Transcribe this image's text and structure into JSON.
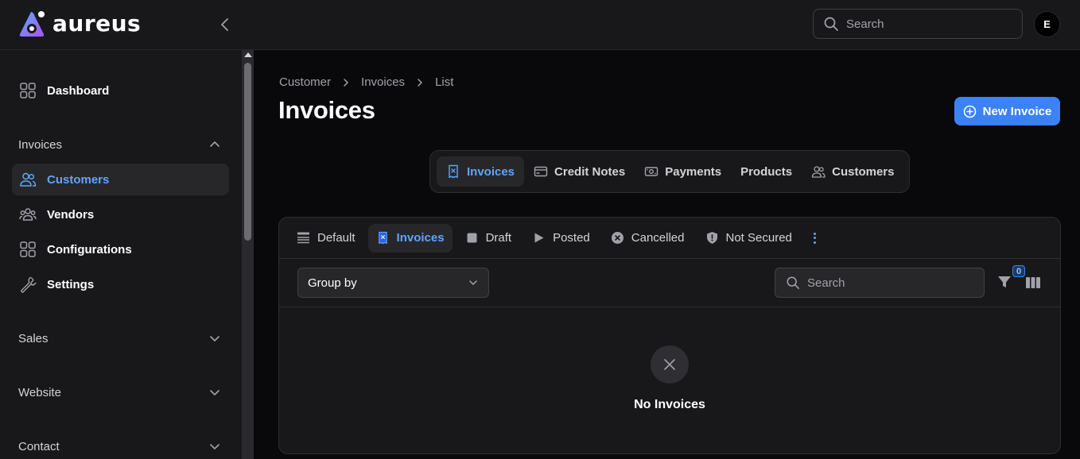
{
  "app": {
    "name": "aureus"
  },
  "header": {
    "search_placeholder": "Search",
    "avatar_initial": "E"
  },
  "sidebar": {
    "items": [
      {
        "label": "Dashboard",
        "icon": "grid-icon"
      }
    ],
    "groups": [
      {
        "label": "Invoices",
        "expanded": true,
        "items": [
          {
            "label": "Customers",
            "icon": "users-icon",
            "active": true
          },
          {
            "label": "Vendors",
            "icon": "group-icon"
          },
          {
            "label": "Configurations",
            "icon": "grid-icon"
          },
          {
            "label": "Settings",
            "icon": "wrench-icon"
          }
        ]
      },
      {
        "label": "Sales",
        "expanded": false
      },
      {
        "label": "Website",
        "expanded": false
      },
      {
        "label": "Contact",
        "expanded": false
      }
    ]
  },
  "main": {
    "breadcrumb": [
      "Customer",
      "Invoices",
      "List"
    ],
    "title": "Invoices",
    "new_button": "New Invoice",
    "tabs": [
      {
        "label": "Invoices",
        "icon": "receipt-icon",
        "active": true
      },
      {
        "label": "Credit Notes",
        "icon": "credit-card-icon"
      },
      {
        "label": "Payments",
        "icon": "banknote-icon"
      },
      {
        "label": "Products",
        "icon": ""
      },
      {
        "label": "Customers",
        "icon": "users-icon"
      }
    ],
    "filters": [
      {
        "label": "Default",
        "icon": "list-icon"
      },
      {
        "label": "Invoices",
        "icon": "receipt-icon",
        "active": true
      },
      {
        "label": "Draft",
        "icon": "square-icon"
      },
      {
        "label": "Posted",
        "icon": "play-icon"
      },
      {
        "label": "Cancelled",
        "icon": "x-circle-icon"
      },
      {
        "label": "Not Secured",
        "icon": "shield-alert-icon"
      }
    ],
    "group_by": {
      "value": "Group by"
    },
    "table_search_placeholder": "Search",
    "filter_count": "0",
    "empty_message": "No Invoices"
  },
  "colors": {
    "accent": "#3b82f6",
    "active_text": "#60a5fa",
    "background": "#09090b",
    "surface": "#18181b"
  }
}
